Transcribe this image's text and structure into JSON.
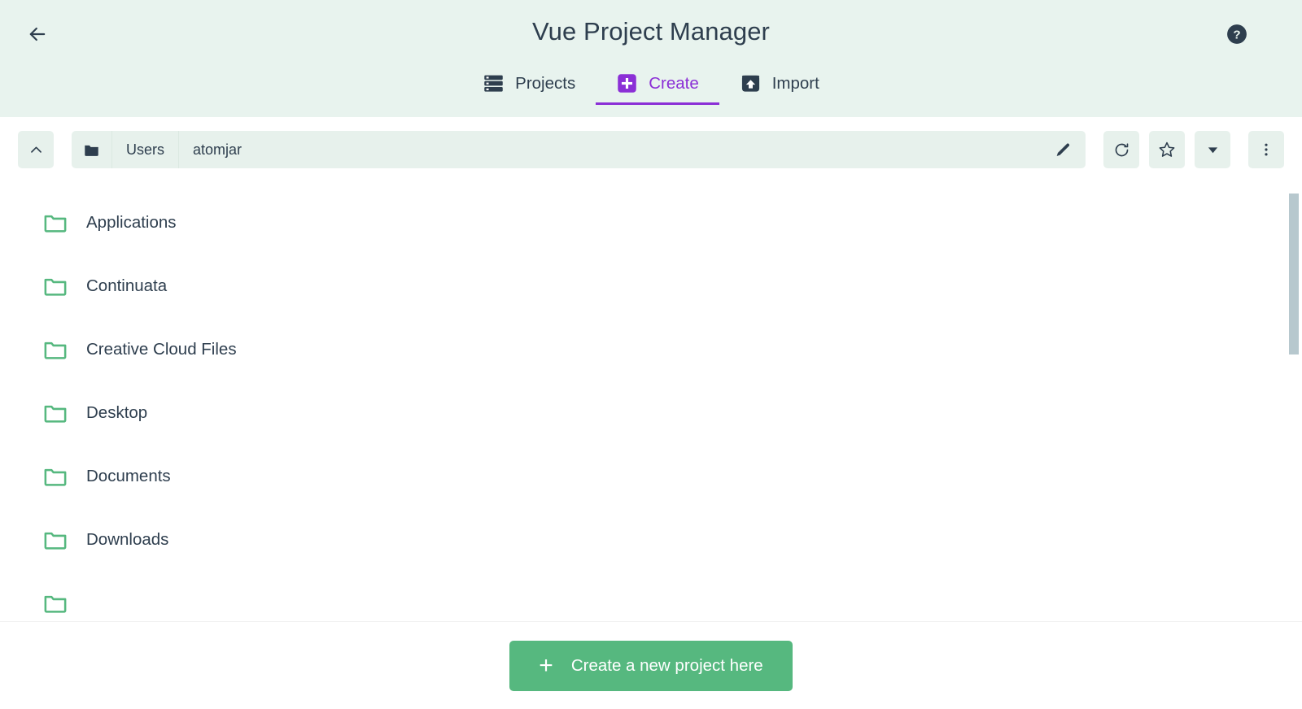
{
  "header": {
    "title": "Vue Project Manager",
    "back_icon": "arrow-left-icon",
    "help_icon": "help-circle-icon"
  },
  "tabs": [
    {
      "label": "Projects",
      "icon": "server-rack-icon",
      "active": false
    },
    {
      "label": "Create",
      "icon": "plus-square-icon",
      "active": true
    },
    {
      "label": "Import",
      "icon": "upload-square-icon",
      "active": false
    }
  ],
  "colors": {
    "header_bg": "#e8f3ee",
    "accent_purple": "#8b2fd6",
    "folder_green": "#56b87f",
    "button_green": "#56b87f",
    "text_dark": "#2e3e4e",
    "field_bg": "#e7f1ec",
    "scrollbar": "#b7c8ce"
  },
  "pathbar": {
    "up_icon": "chevron-up-icon",
    "folder_icon": "folder-filled-icon",
    "crumbs": [
      "Users",
      "atomjar"
    ],
    "edit_icon": "pencil-icon",
    "refresh_icon": "refresh-icon",
    "favorite_icon": "star-icon",
    "dropdown_icon": "chevron-down-icon",
    "more_icon": "more-vertical-icon"
  },
  "files": [
    {
      "name": "Applications",
      "icon": "folder-icon"
    },
    {
      "name": "Continuata",
      "icon": "folder-icon"
    },
    {
      "name": "Creative Cloud Files",
      "icon": "folder-icon"
    },
    {
      "name": "Desktop",
      "icon": "folder-icon"
    },
    {
      "name": "Documents",
      "icon": "folder-icon"
    },
    {
      "name": "Downloads",
      "icon": "folder-icon"
    },
    {
      "name": "",
      "icon": "folder-icon"
    }
  ],
  "footer": {
    "create_label": "Create a new project here",
    "create_icon": "plus-icon"
  }
}
